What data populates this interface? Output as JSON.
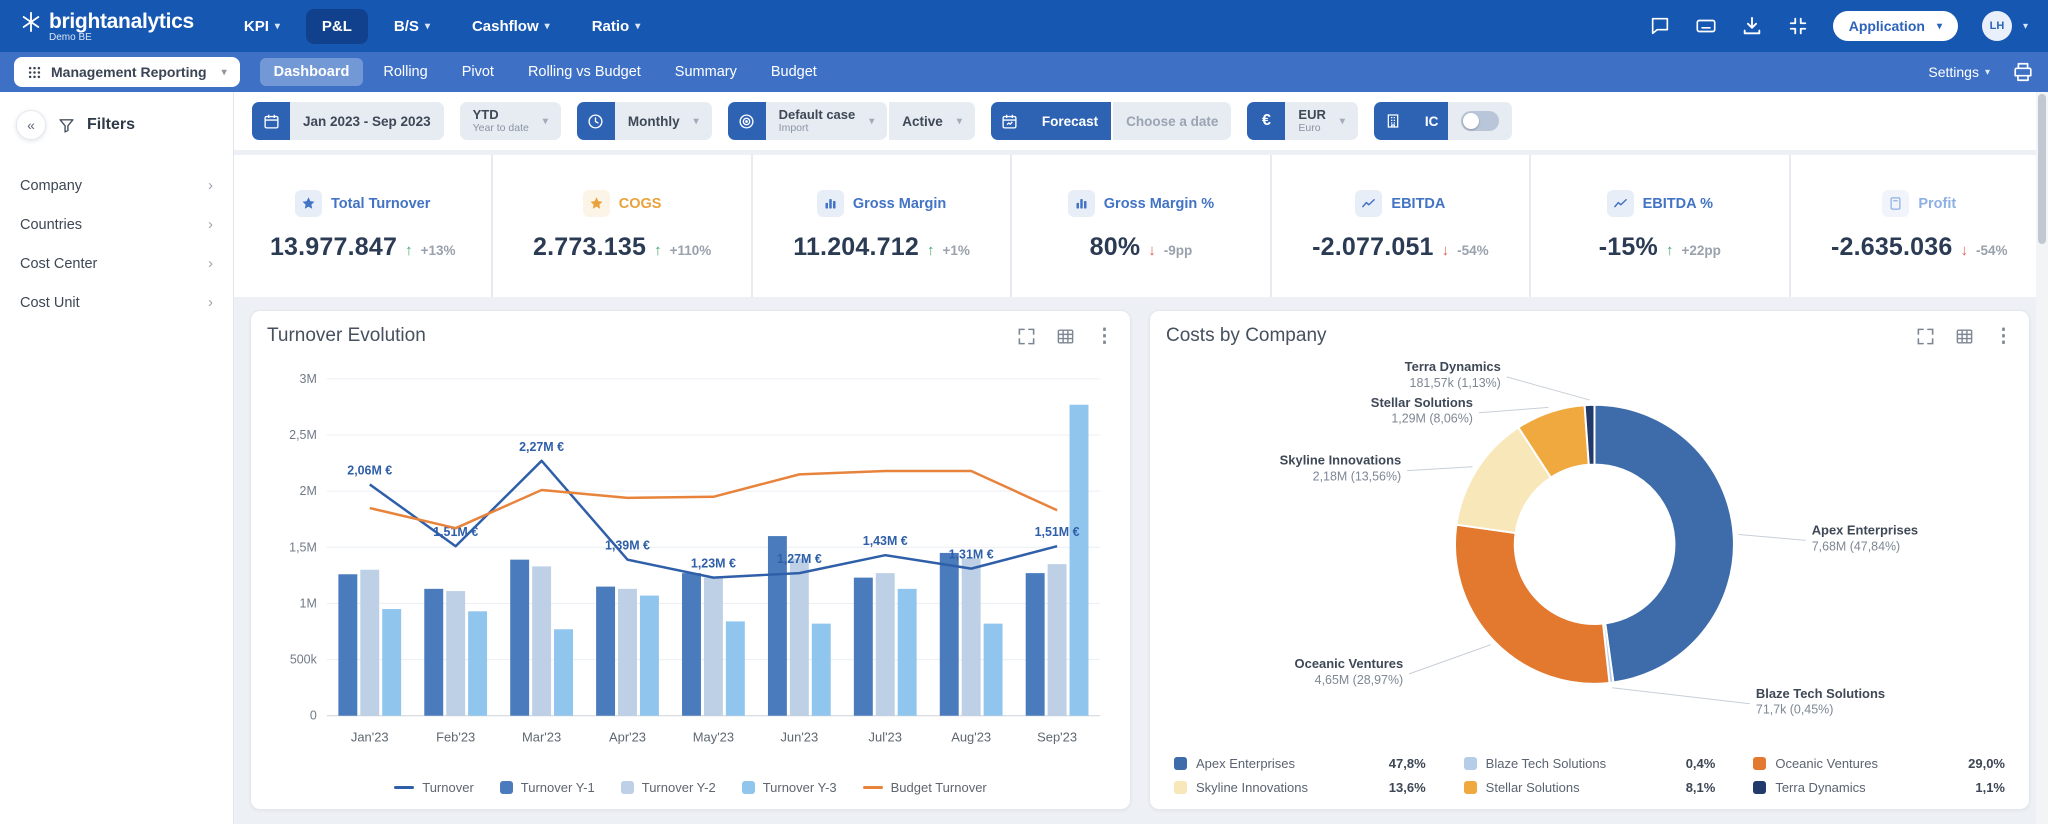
{
  "topbar": {
    "logo_text": "brightanalytics",
    "env_label": "Demo BE",
    "nav": [
      {
        "label": "KPI"
      },
      {
        "label": "P&L"
      },
      {
        "label": "B/S"
      },
      {
        "label": "Cashflow"
      },
      {
        "label": "Ratio"
      }
    ],
    "application_button": "Application",
    "avatar_initials": "LH"
  },
  "subbar": {
    "report_selector": "Management Reporting",
    "tabs": [
      {
        "label": "Dashboard"
      },
      {
        "label": "Rolling"
      },
      {
        "label": "Pivot"
      },
      {
        "label": "Rolling vs Budget"
      },
      {
        "label": "Summary"
      },
      {
        "label": "Budget"
      }
    ],
    "settings_label": "Settings"
  },
  "filter_bar": {
    "date_range": "Jan 2023 - Sep 2023",
    "ytd_label": "YTD",
    "ytd_sub": "Year to date",
    "period": "Monthly",
    "case_label": "Default case",
    "case_sub": "Import",
    "status": "Active",
    "forecast_label": "Forecast",
    "choose_date_label": "Choose a date",
    "currency_code": "EUR",
    "currency_name": "Euro",
    "ic_label": "IC"
  },
  "sidebar": {
    "title": "Filters",
    "items": [
      {
        "label": "Company"
      },
      {
        "label": "Countries"
      },
      {
        "label": "Cost Center"
      },
      {
        "label": "Cost Unit"
      }
    ]
  },
  "kpis": [
    {
      "label": "Total Turnover",
      "value": "13.977.847",
      "delta": "+13%",
      "direction": "up",
      "icon": "star",
      "accent": "#4273c4"
    },
    {
      "label": "COGS",
      "value": "2.773.135",
      "delta": "+110%",
      "direction": "up",
      "icon": "star",
      "accent": "#e9a23b"
    },
    {
      "label": "Gross Margin",
      "value": "11.204.712",
      "delta": "+1%",
      "direction": "up",
      "icon": "bars",
      "accent": "#4273c4"
    },
    {
      "label": "Gross Margin %",
      "value": "80%",
      "delta": "-9pp",
      "direction": "down",
      "icon": "bars",
      "accent": "#4273c4"
    },
    {
      "label": "EBITDA",
      "value": "-2.077.051",
      "delta": "-54%",
      "direction": "down",
      "icon": "trend",
      "accent": "#4273c4"
    },
    {
      "label": "EBITDA %",
      "value": "-15%",
      "delta": "+22pp",
      "direction": "up",
      "icon": "trend",
      "accent": "#4273c4"
    },
    {
      "label": "Profit",
      "value": "-2.635.036",
      "delta": "-54%",
      "direction": "down",
      "icon": "calc",
      "accent": "#8db0e2"
    }
  ],
  "chart_data": [
    {
      "type": "bar",
      "title": "Turnover Evolution",
      "categories": [
        "Jan'23",
        "Feb'23",
        "Mar'23",
        "Apr'23",
        "May'23",
        "Jun'23",
        "Jul'23",
        "Aug'23",
        "Sep'23"
      ],
      "ylim": [
        0,
        3
      ],
      "yticks": [
        {
          "v": 0,
          "label": "0"
        },
        {
          "v": 0.5,
          "label": "500k"
        },
        {
          "v": 1,
          "label": "1M"
        },
        {
          "v": 1.5,
          "label": "1,5M"
        },
        {
          "v": 2,
          "label": "2M"
        },
        {
          "v": 2.5,
          "label": "2,5M"
        },
        {
          "v": 3,
          "label": "3M"
        }
      ],
      "bar_series": [
        {
          "name": "Turnover Y-1",
          "color": "#4a7cbd",
          "values": [
            1.26,
            1.13,
            1.39,
            1.15,
            1.27,
            1.6,
            1.23,
            1.45,
            1.27
          ]
        },
        {
          "name": "Turnover Y-2",
          "color": "#bdd0e5",
          "values": [
            1.3,
            1.11,
            1.33,
            1.13,
            1.23,
            1.4,
            1.27,
            1.4,
            1.35
          ]
        },
        {
          "name": "Turnover Y-3",
          "color": "#90c5ee",
          "values": [
            0.95,
            0.93,
            0.77,
            1.07,
            0.84,
            0.82,
            1.13,
            0.82,
            2.77
          ]
        }
      ],
      "line_series": [
        {
          "name": "Turnover",
          "color": "#2f5fa9",
          "values": [
            2.06,
            1.51,
            2.27,
            1.39,
            1.23,
            1.27,
            1.43,
            1.31,
            1.51
          ],
          "point_labels": [
            "2,06M €",
            "1,51M €",
            "2,27M €",
            "1,39M €",
            "1,23M €",
            "1,27M €",
            "1,43M €",
            "1,31M €",
            "1,51M €"
          ]
        },
        {
          "name": "Budget Turnover",
          "color": "#e8833c",
          "values": [
            1.85,
            1.67,
            2.01,
            1.94,
            1.95,
            2.15,
            2.18,
            2.18,
            1.83
          ]
        }
      ]
    },
    {
      "type": "pie",
      "title": "Costs by Company",
      "slices": [
        {
          "name": "Apex Enterprises",
          "value_label": "7,68M",
          "pct": 47.84,
          "pct_label": "(47,84%)",
          "legend_pct": "47,8%",
          "color": "#3e6cab"
        },
        {
          "name": "Blaze Tech Solutions",
          "value_label": "71,7k",
          "pct": 0.45,
          "pct_label": "(0,45%)",
          "legend_pct": "0,4%",
          "color": "#b6cde9"
        },
        {
          "name": "Oceanic Ventures",
          "value_label": "4,65M",
          "pct": 28.97,
          "pct_label": "(28,97%)",
          "legend_pct": "29,0%",
          "color": "#e2792f"
        },
        {
          "name": "Skyline Innovations",
          "value_label": "2,18M",
          "pct": 13.56,
          "pct_label": "(13,56%)",
          "legend_pct": "13,6%",
          "color": "#f8e7b9"
        },
        {
          "name": "Stellar Solutions",
          "value_label": "1,29M",
          "pct": 8.06,
          "pct_label": "(8,06%)",
          "legend_pct": "8,1%",
          "color": "#efa93f"
        },
        {
          "name": "Terra Dynamics",
          "value_label": "181,57k",
          "pct": 1.13,
          "pct_label": "(1,13%)",
          "legend_pct": "1,1%",
          "color": "#21396b"
        }
      ]
    }
  ]
}
